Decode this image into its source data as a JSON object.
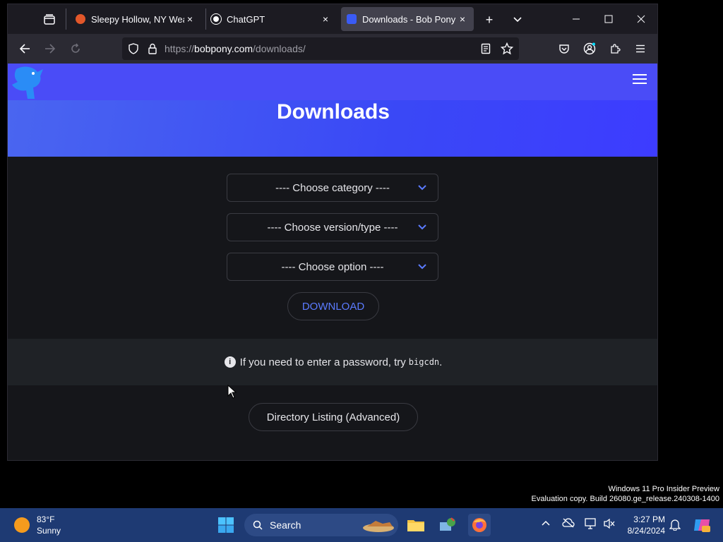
{
  "browser": {
    "tabs": [
      {
        "title": "Sleepy Hollow, NY Weath",
        "close": "×"
      },
      {
        "title": "ChatGPT",
        "close": "×"
      },
      {
        "title": "Downloads - Bob Pony",
        "close": "×"
      }
    ],
    "new_tab": "+",
    "url": {
      "prefix": "https://",
      "host": "bobpony.com",
      "path": "/downloads/"
    }
  },
  "page": {
    "title": "Downloads",
    "selects": [
      {
        "label": "---- Choose category ----"
      },
      {
        "label": "---- Choose version/type ----"
      },
      {
        "label": "---- Choose option ----"
      }
    ],
    "download_label": "DOWNLOAD",
    "notice": {
      "text": "If you need to enter a password, try",
      "code": "bigcdn",
      "end": "."
    },
    "directory_label": "Directory Listing (Advanced)"
  },
  "watermark": {
    "line1": "Windows 11 Pro Insider Preview",
    "line2": "Evaluation copy. Build 26080.ge_release.240308-1400"
  },
  "taskbar": {
    "weather": {
      "temp": "83°F",
      "condition": "Sunny"
    },
    "search_label": "Search",
    "time": "3:27 PM",
    "date": "8/24/2024"
  },
  "colors": {
    "accent": "#5b7bff",
    "hero": "#4a4cf7",
    "taskbar": "#1e3a73"
  }
}
